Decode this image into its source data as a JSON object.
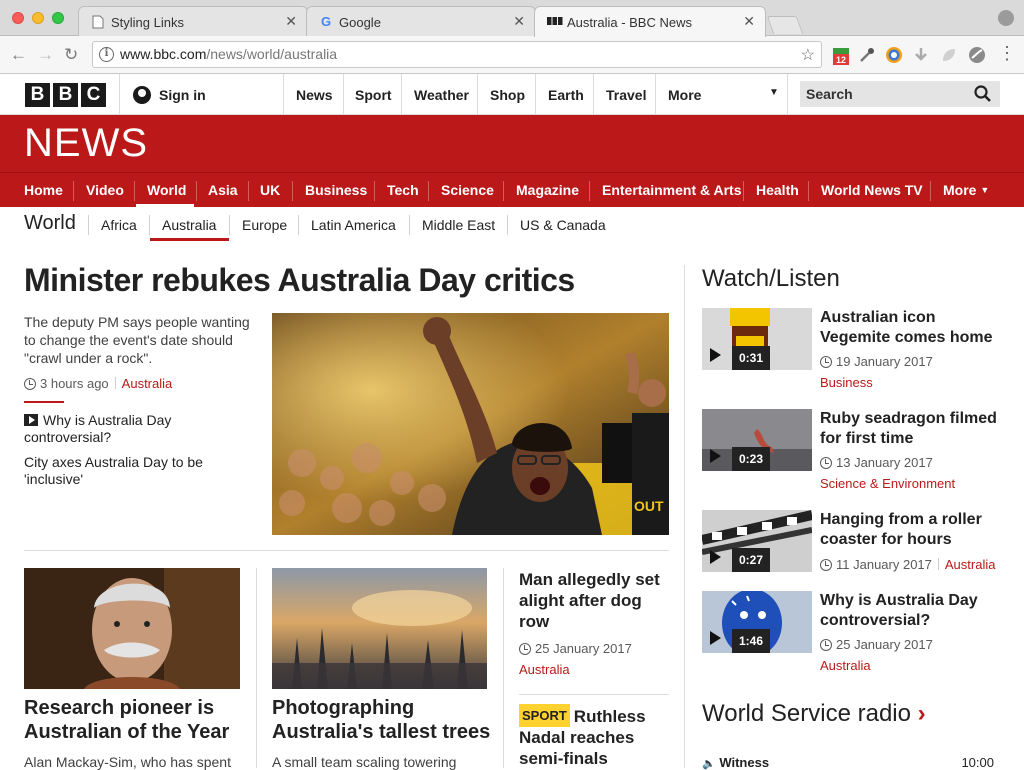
{
  "browser": {
    "tabs": [
      {
        "title": "Styling Links",
        "icon": "document-icon"
      },
      {
        "title": "Google",
        "icon": "google-icon"
      },
      {
        "title": "Australia - BBC News",
        "icon": "bbc-icon",
        "active": true
      }
    ],
    "url_host": "www.bbc.com",
    "url_path": "/news/world/australia",
    "extension_badge": "12"
  },
  "global_nav": {
    "logo_letters": [
      "B",
      "B",
      "C"
    ],
    "sign_in": "Sign in",
    "links": [
      "News",
      "Sport",
      "Weather",
      "Shop",
      "Earth",
      "Travel",
      "More"
    ],
    "search_label": "Search"
  },
  "masthead": {
    "title": "NEWS",
    "color": "#bb1919"
  },
  "news_nav": [
    "Home",
    "Video",
    "World",
    "Asia",
    "UK",
    "Business",
    "Tech",
    "Science",
    "Magazine",
    "Entertainment & Arts",
    "Health",
    "World News TV",
    "More"
  ],
  "world_nav": {
    "title": "World",
    "items": [
      "Africa",
      "Australia",
      "Europe",
      "Latin America",
      "Middle East",
      "US & Canada"
    ],
    "active": "Australia"
  },
  "lead": {
    "headline": "Minister rebukes Australia Day critics",
    "summary": "The deputy PM says people wanting to change the event's date should \"crawl under a rock\".",
    "time": "3 hours ago",
    "tag": "Australia",
    "related": [
      "Why is Australia Day controversial?",
      "City axes Australia Day to be 'inclusive'"
    ]
  },
  "stories": [
    {
      "title": "Research pioneer is Australian of the Year",
      "summary": "Alan Mackay-Sim, who has spent"
    },
    {
      "title": "Photographing Australia's tallest trees",
      "summary": "A small team scaling towering"
    },
    {
      "title": "Man allegedly set alight after dog row",
      "time": "25 January 2017",
      "tag": "Australia"
    },
    {
      "badge": "SPORT",
      "title_first": "Ruthless",
      "title_rest": "Nadal reaches semi-finals"
    }
  ],
  "watch_listen": {
    "heading": "Watch/Listen",
    "items": [
      {
        "title": "Australian icon Vegemite comes home",
        "duration": "0:31",
        "date": "19 January 2017",
        "tag": "Business"
      },
      {
        "title": "Ruby seadragon filmed for first time",
        "duration": "0:23",
        "date": "13 January 2017",
        "tag": "Science & Environment"
      },
      {
        "title": "Hanging from a roller coaster for hours",
        "duration": "0:27",
        "date": "11 January 2017",
        "tag": "Australia"
      },
      {
        "title": "Why is Australia Day controversial?",
        "duration": "1:46",
        "date": "25 January 2017",
        "tag": "Australia"
      }
    ]
  },
  "world_service": {
    "heading": "World Service radio",
    "program": "Witness",
    "time": "10:00"
  }
}
